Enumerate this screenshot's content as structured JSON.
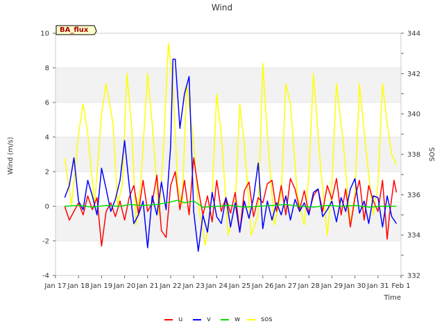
{
  "chart_data": {
    "type": "line",
    "title": "Wind",
    "xlabel": "Time",
    "ylabel_left": "Wind (m/s)",
    "ylabel_right": "SOS",
    "badge": "BA_flux",
    "x_range": [
      17,
      32
    ],
    "x_ticks": [
      17,
      18,
      19,
      20,
      21,
      22,
      23,
      24,
      25,
      26,
      27,
      28,
      29,
      30,
      31,
      32
    ],
    "x_tick_labels": [
      "Jan 17",
      "Jan 18",
      "Jan 19",
      "Jan 20",
      "Jan 21",
      "Jan 22",
      "Jan 23",
      "Jan 24",
      "Jan 25",
      "Jan 26",
      "Jan 27",
      "Jan 28",
      "Jan 29",
      "Jan 30",
      "Jan 31",
      "Feb 1"
    ],
    "ylim_left": [
      -4,
      10
    ],
    "y_ticks_left": [
      -4,
      -2,
      0,
      2,
      4,
      6,
      8,
      10
    ],
    "ylim_right": [
      332,
      344
    ],
    "y_ticks_right": [
      332,
      334,
      336,
      338,
      340,
      342,
      344
    ],
    "grid_bands": true,
    "legend_position": "bottom-center",
    "series": [
      {
        "name": "u",
        "axis": "left",
        "color": "#ff0000",
        "x": [
          17.4,
          17.6,
          17.8,
          18.0,
          18.2,
          18.4,
          18.6,
          18.8,
          19.0,
          19.2,
          19.4,
          19.6,
          19.8,
          20.0,
          20.2,
          20.4,
          20.6,
          20.8,
          21.0,
          21.2,
          21.4,
          21.6,
          21.8,
          22.0,
          22.2,
          22.4,
          22.6,
          22.8,
          23.0,
          23.2,
          23.4,
          23.6,
          23.8,
          24.0,
          24.2,
          24.4,
          24.6,
          24.8,
          25.0,
          25.2,
          25.4,
          25.6,
          25.8,
          26.0,
          26.2,
          26.4,
          26.6,
          26.8,
          27.0,
          27.2,
          27.4,
          27.6,
          27.8,
          28.0,
          28.2,
          28.4,
          28.6,
          28.8,
          29.0,
          29.2,
          29.4,
          29.6,
          29.8,
          30.0,
          30.2,
          30.4,
          30.6,
          30.8,
          31.0,
          31.2,
          31.4,
          31.5,
          31.6,
          31.7,
          31.8
        ],
        "values": [
          0,
          -0.8,
          -0.3,
          0.2,
          -0.5,
          0.6,
          -0.2,
          0.5,
          -2.3,
          -0.3,
          0.2,
          -0.6,
          0.3,
          -0.8,
          0.5,
          1.2,
          -0.4,
          1.5,
          -0.3,
          0.2,
          1.8,
          -1.4,
          -1.8,
          1.2,
          2.0,
          -0.2,
          1.5,
          -0.5,
          2.8,
          1.0,
          -0.5,
          0.6,
          -0.9,
          1.5,
          -0.3,
          0.5,
          -0.4,
          0.8,
          -1.5,
          0.9,
          1.4,
          -0.6,
          0.5,
          0.2,
          1.3,
          1.5,
          -0.3,
          1.2,
          -0.5,
          1.6,
          1.0,
          -0.2,
          0.9,
          -0.4,
          0.6,
          1.0,
          -0.3,
          1.2,
          0.4,
          1.6,
          -0.5,
          1.0,
          -1.2,
          0.5,
          1.5,
          -0.8,
          1.2,
          0.3,
          -0.3,
          1.5,
          -1.9,
          -0.5,
          0.5,
          1.5,
          0.8
        ]
      },
      {
        "name": "v",
        "axis": "left",
        "color": "#0000ff",
        "x": [
          17.4,
          17.6,
          17.8,
          18.0,
          18.2,
          18.4,
          18.6,
          18.8,
          19.0,
          19.2,
          19.4,
          19.6,
          19.8,
          20.0,
          20.2,
          20.4,
          20.6,
          20.8,
          21.0,
          21.2,
          21.4,
          21.6,
          21.8,
          22.0,
          22.1,
          22.2,
          22.4,
          22.6,
          22.8,
          23.0,
          23.2,
          23.4,
          23.6,
          23.8,
          24.0,
          24.2,
          24.4,
          24.6,
          24.8,
          25.0,
          25.2,
          25.4,
          25.6,
          25.8,
          26.0,
          26.2,
          26.4,
          26.6,
          26.8,
          27.0,
          27.2,
          27.4,
          27.6,
          27.8,
          28.0,
          28.2,
          28.4,
          28.6,
          28.8,
          29.0,
          29.2,
          29.4,
          29.6,
          29.8,
          30.0,
          30.2,
          30.4,
          30.6,
          30.8,
          31.0,
          31.2,
          31.4,
          31.6,
          31.8
        ],
        "values": [
          0.5,
          1.2,
          2.8,
          0.3,
          -0.2,
          1.5,
          0.6,
          -0.5,
          2.2,
          1.0,
          -0.3,
          0.4,
          1.5,
          3.8,
          1.2,
          -1.0,
          -0.5,
          0.3,
          -2.4,
          0.6,
          -0.5,
          1.4,
          -0.2,
          3.5,
          8.5,
          8.5,
          4.5,
          6.5,
          7.5,
          -0.3,
          -2.6,
          -0.5,
          -1.5,
          0.8,
          -0.6,
          -1.0,
          0.5,
          -1.2,
          0.2,
          -1.5,
          0.3,
          -0.7,
          0.5,
          2.5,
          -1.3,
          0.3,
          -0.8,
          0.2,
          -0.5,
          0.6,
          -0.8,
          0.4,
          -0.3,
          0.2,
          -0.5,
          0.8,
          1.0,
          -0.6,
          -0.2,
          0.3,
          -0.9,
          0.5,
          -0.3,
          1.0,
          1.6,
          -0.4,
          0.3,
          -1.0,
          0.6,
          0.5,
          -1.2,
          0.6,
          -0.6,
          -1.0
        ]
      },
      {
        "name": "w",
        "axis": "left",
        "color": "#00dd00",
        "x": [
          17.4,
          18.0,
          18.6,
          19.2,
          19.8,
          20.2,
          20.8,
          21.4,
          22.0,
          22.3,
          22.6,
          23.0,
          23.4,
          24.0,
          24.6,
          25.2,
          25.8,
          26.4,
          27.0,
          27.6,
          28.2,
          28.8,
          29.4,
          30.0,
          30.6,
          31.2,
          31.8
        ],
        "values": [
          0,
          0.05,
          -0.05,
          0.05,
          0.0,
          0.1,
          0.05,
          0.1,
          0.25,
          0.35,
          0.2,
          0.3,
          -0.05,
          0.0,
          0.05,
          -0.05,
          0.0,
          0.05,
          0.1,
          0.0,
          -0.05,
          0.05,
          0.0,
          0.05,
          -0.05,
          0.0,
          0.0
        ]
      },
      {
        "name": "sos",
        "axis": "right",
        "color": "#ffff00",
        "x": [
          17.4,
          17.7,
          18.0,
          18.2,
          18.4,
          18.7,
          19.0,
          19.2,
          19.5,
          19.7,
          19.9,
          20.1,
          20.3,
          20.5,
          20.7,
          21.0,
          21.2,
          21.5,
          21.7,
          21.9,
          22.1,
          22.3,
          22.5,
          22.7,
          23.0,
          23.2,
          23.5,
          23.8,
          24.0,
          24.2,
          24.5,
          24.8,
          25.0,
          25.2,
          25.5,
          25.8,
          26.0,
          26.2,
          26.5,
          26.8,
          27.0,
          27.2,
          27.5,
          27.8,
          28.0,
          28.2,
          28.5,
          28.8,
          29.0,
          29.2,
          29.5,
          29.8,
          30.0,
          30.2,
          30.5,
          30.8,
          31.0,
          31.2,
          31.4,
          31.6,
          31.8
        ],
        "values": [
          337.8,
          335.5,
          339.0,
          340.5,
          339.0,
          335.5,
          340.0,
          341.5,
          339.5,
          335.5,
          336.5,
          342.0,
          339.5,
          334.5,
          336.5,
          342.0,
          339.5,
          335.0,
          338.5,
          343.5,
          341.5,
          336.5,
          335.5,
          341.5,
          338.5,
          335.5,
          333.5,
          336.0,
          341.0,
          339.0,
          334.0,
          335.5,
          340.5,
          338.5,
          334.0,
          335.0,
          342.5,
          339.0,
          334.5,
          336.0,
          341.5,
          340.5,
          336.0,
          334.5,
          337.0,
          342.0,
          337.5,
          334.0,
          336.5,
          341.5,
          338.5,
          334.5,
          336.0,
          341.5,
          338.0,
          335.0,
          336.5,
          341.5,
          339.5,
          338.0,
          337.5
        ]
      }
    ]
  }
}
